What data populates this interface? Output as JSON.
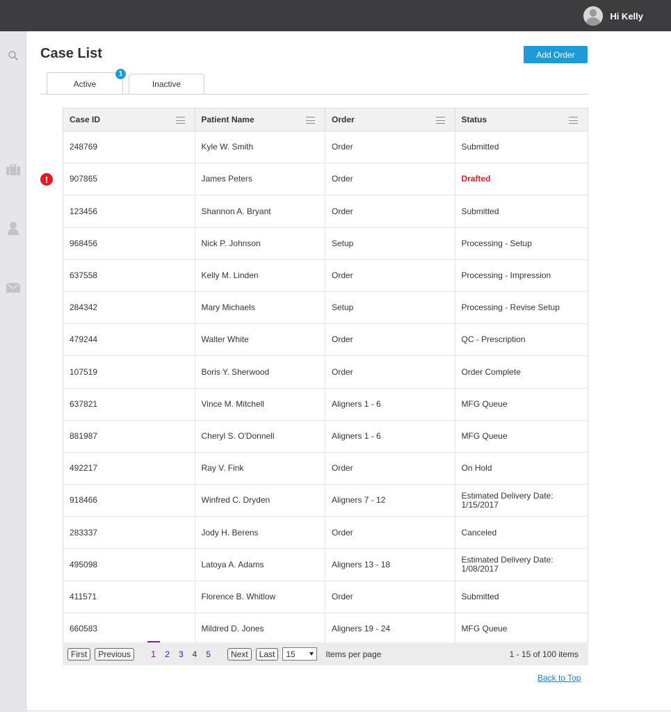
{
  "header": {
    "greeting": "Hi Kelly"
  },
  "sidebar": {
    "icons": [
      "search-icon",
      "briefcase-icon",
      "person-icon",
      "mail-icon"
    ]
  },
  "page": {
    "title": "Case List",
    "add_order_label": "Add Order"
  },
  "tabs": {
    "active_label": "Active",
    "inactive_label": "Inactive",
    "badge_count": "1"
  },
  "table": {
    "headers": [
      "Case ID",
      "Patient Name",
      "Order",
      "Status"
    ],
    "rows": [
      {
        "id": "248769",
        "name": "Kyle W. Smith",
        "order": "Order",
        "status": "Submitted"
      },
      {
        "id": "907865",
        "name": "James Peters",
        "order": "Order",
        "status": "Drafted",
        "alert": "!"
      },
      {
        "id": "123456",
        "name": "Shannon A. Bryant",
        "order": "Order",
        "status": "Submitted"
      },
      {
        "id": "968456",
        "name": "Nick P. Johnson",
        "order": "Setup",
        "status": "Processing - Setup"
      },
      {
        "id": "637558",
        "name": "Kelly M. Linden",
        "order": "Order",
        "status": "Processing - Impression"
      },
      {
        "id": "284342",
        "name": "Mary Michaels",
        "order": "Setup",
        "status": "Processing - Revise Setup"
      },
      {
        "id": "479244",
        "name": "Walter White",
        "order": "Order",
        "status": "QC - Prescription"
      },
      {
        "id": "107519",
        "name": "Boris Y. Sherwood",
        "order": "Order",
        "status": "Order Complete"
      },
      {
        "id": "637821",
        "name": "Vince M. Mitchell",
        "order": "Aligners 1 - 6",
        "status": "MFG Queue"
      },
      {
        "id": "881987",
        "name": "Cheryl S. O'Donnell",
        "order": "Aligners 1 - 6",
        "status": "MFG Queue"
      },
      {
        "id": "492217",
        "name": "Ray V. Fink",
        "order": "Order",
        "status": "On Hold"
      },
      {
        "id": "918466",
        "name": "Winfred C. Dryden",
        "order": "Aligners 7 - 12",
        "status": "Estimated Delivery Date: 1/15/2017"
      },
      {
        "id": "283337",
        "name": "Jody H. Berens",
        "order": "Order",
        "status": "Canceled"
      },
      {
        "id": "495098",
        "name": "Latoya A. Adams",
        "order": "Aligners 13 - 18",
        "status": "Estimated Delivery Date: 1/08/2017"
      },
      {
        "id": "411571",
        "name": "Florence B. Whitlow",
        "order": "Order",
        "status": "Submitted"
      },
      {
        "id": "660583",
        "name": "Mildred D. Jones",
        "order": "Aligners 19 - 24",
        "status": "MFG Queue"
      }
    ]
  },
  "pager": {
    "first": "First",
    "previous": "Previous",
    "next": "Next",
    "last": "Last",
    "pages": [
      "1",
      "2",
      "3",
      "4",
      "5"
    ],
    "current_page": "1",
    "page_size": "15",
    "items_per_page_label": "Items per page",
    "summary": "1 - 15 of 100 items"
  },
  "footer": {
    "back_to_top": "Back to Top"
  },
  "colors": {
    "accent": "#1f9ad9",
    "alert": "#e21b23",
    "topbar": "#3d3d40"
  }
}
